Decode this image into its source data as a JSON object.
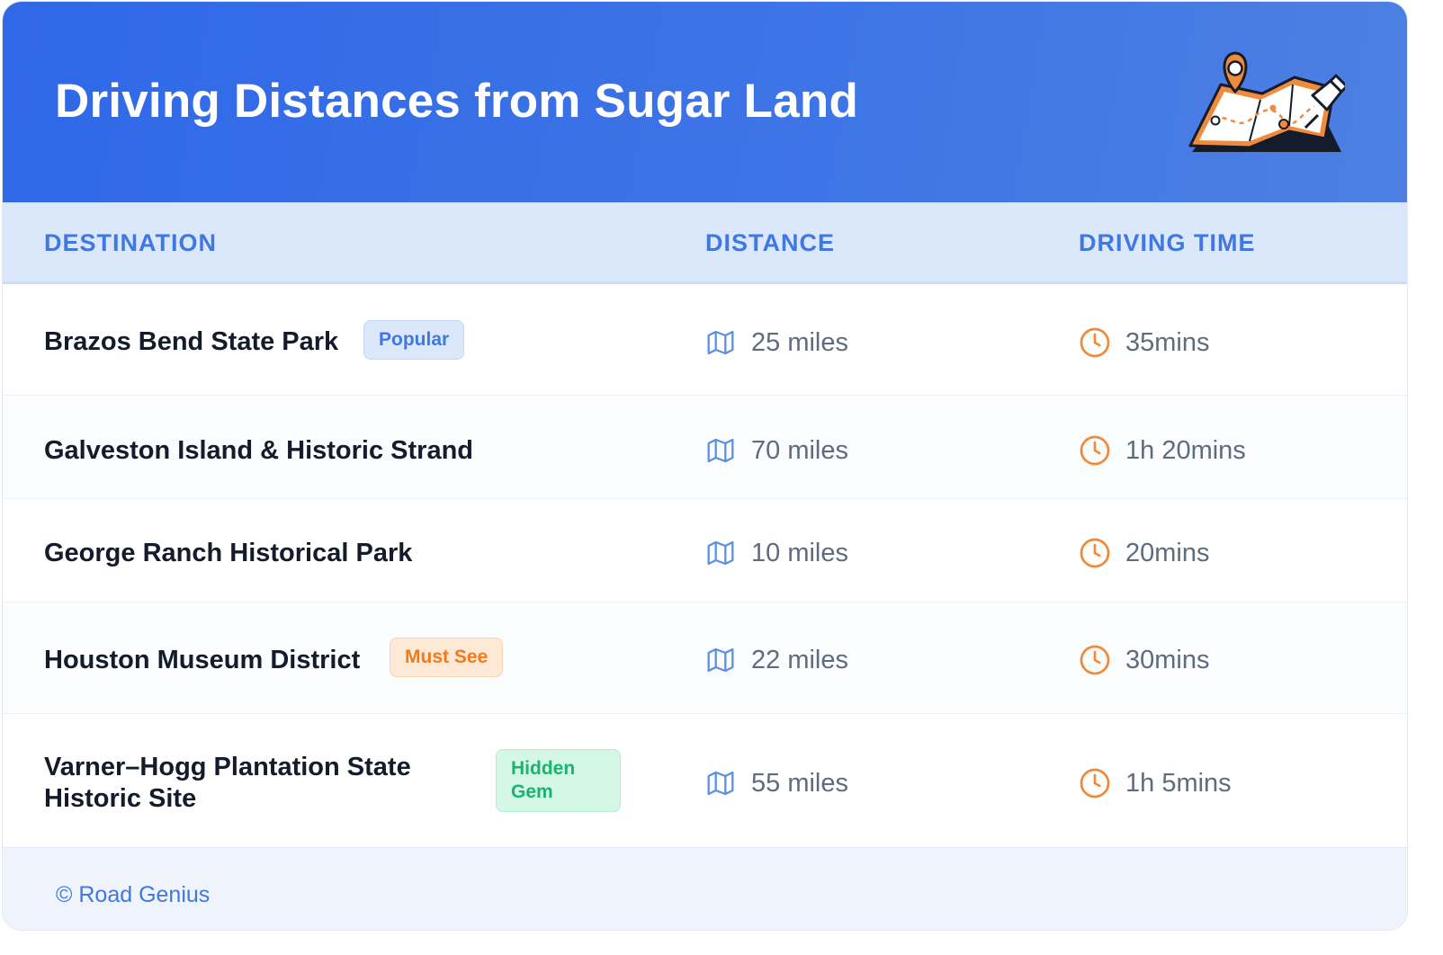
{
  "header": {
    "title": "Driving Distances from Sugar Land",
    "illustration": "map-pin-icon"
  },
  "table": {
    "columns": [
      "DESTINATION",
      "DISTANCE",
      "DRIVING TIME"
    ],
    "distance_icon": "map-icon",
    "time_icon": "clock-icon",
    "rows": [
      {
        "destination": "Brazos Bend State Park",
        "badge": "Popular",
        "distance": "25 miles",
        "time": "35mins"
      },
      {
        "destination": "Galveston Island & Historic Strand",
        "badge": "",
        "distance": "70 miles",
        "time": "1h 20mins"
      },
      {
        "destination": "George Ranch Historical Park",
        "badge": "",
        "distance": "10 miles",
        "time": "20mins"
      },
      {
        "destination": "Houston Museum District",
        "badge": "Must See",
        "distance": "22 miles",
        "time": "30mins"
      },
      {
        "destination": "Varner–Hogg Plantation State Historic Site",
        "badge": "Hidden Gem",
        "distance": "55 miles",
        "time": "1h 5mins"
      }
    ]
  },
  "footer": {
    "credit": "© Road Genius"
  },
  "colors": {
    "header_start": "#2f68e8",
    "header_end": "#4d80e2",
    "accent_blue": "#3f78e0",
    "accent_orange": "#ef8a3a",
    "accent_green": "#1cb36e"
  }
}
